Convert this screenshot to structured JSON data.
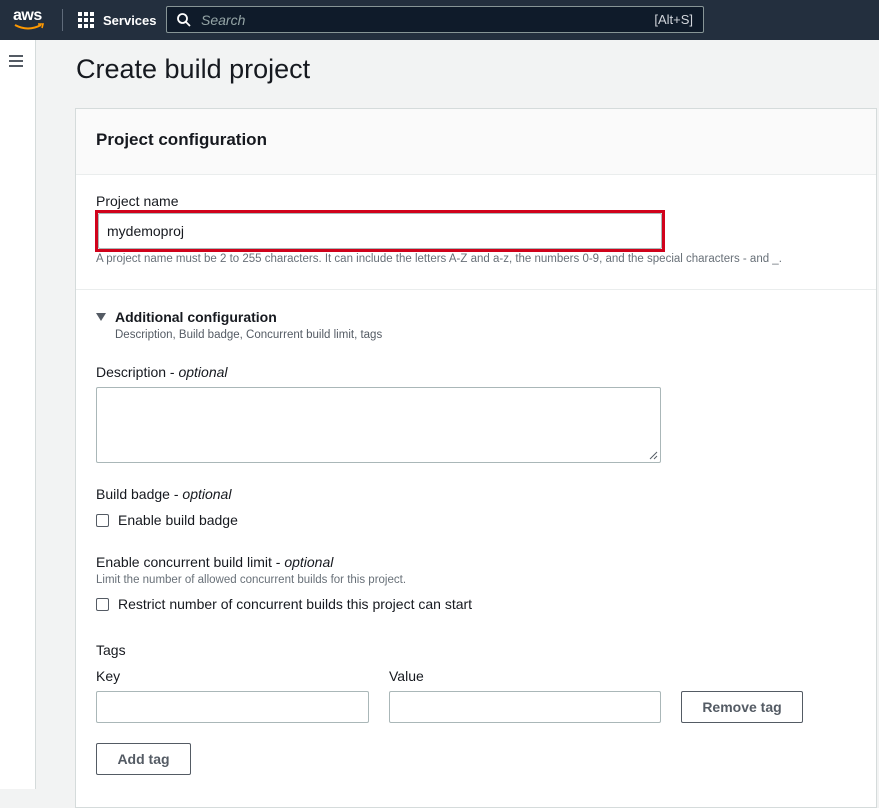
{
  "topnav": {
    "logo_text": "aws",
    "services_label": "Services",
    "search_placeholder": "Search",
    "search_shortcut": "[Alt+S]"
  },
  "page": {
    "title": "Create build project"
  },
  "panel": {
    "title": "Project configuration",
    "project_name": {
      "label": "Project name",
      "value": "mydemoproj",
      "hint": "A project name must be 2 to 255 characters. It can include the letters A-Z and a-z, the numbers 0-9, and the special characters - and _."
    },
    "additional": {
      "title": "Additional configuration",
      "subtitle": "Description, Build badge, Concurrent build limit, tags"
    },
    "description": {
      "label": "Description - ",
      "optional": "optional",
      "value": ""
    },
    "build_badge": {
      "label": "Build badge - ",
      "optional": "optional",
      "checkbox_label": "Enable build badge",
      "checked": false
    },
    "concurrent": {
      "label": "Enable concurrent build limit - ",
      "optional": "optional",
      "hint": "Limit the number of allowed concurrent builds for this project.",
      "checkbox_label": "Restrict number of concurrent builds this project can start",
      "checked": false
    },
    "tags": {
      "label": "Tags",
      "key_label": "Key",
      "value_label": "Value",
      "key_value": "",
      "value_value": "",
      "remove_label": "Remove tag",
      "add_label": "Add tag"
    }
  },
  "colors": {
    "nav_bg": "#232f3e",
    "highlight": "#d0021b",
    "page_bg": "#f2f3f3"
  }
}
